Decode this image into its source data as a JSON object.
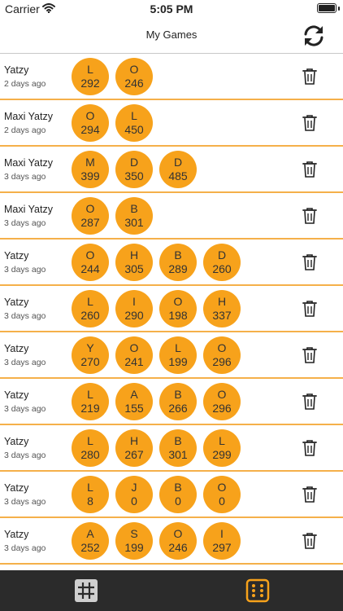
{
  "status": {
    "carrier": "Carrier",
    "time": "5:05 PM"
  },
  "nav": {
    "title": "My Games"
  },
  "icons": {
    "refresh": "refresh-icon",
    "trash": "trash-icon",
    "grid": "grid-tab-icon",
    "dice": "dice-tab-icon"
  },
  "colors": {
    "accent": "#f7a21b",
    "separator": "#f5b04a",
    "tab_bar": "#2b2b2b"
  },
  "games": [
    {
      "name": "Yatzy",
      "time": "2 days ago",
      "players": [
        {
          "initial": "L",
          "score": "292"
        },
        {
          "initial": "O",
          "score": "246"
        }
      ]
    },
    {
      "name": "Maxi Yatzy",
      "time": "2 days ago",
      "players": [
        {
          "initial": "O",
          "score": "294"
        },
        {
          "initial": "L",
          "score": "450"
        }
      ]
    },
    {
      "name": "Maxi Yatzy",
      "time": "3 days ago",
      "players": [
        {
          "initial": "M",
          "score": "399"
        },
        {
          "initial": "D",
          "score": "350"
        },
        {
          "initial": "D",
          "score": "485"
        }
      ]
    },
    {
      "name": "Maxi Yatzy",
      "time": "3 days ago",
      "players": [
        {
          "initial": "O",
          "score": "287"
        },
        {
          "initial": "B",
          "score": "301"
        }
      ]
    },
    {
      "name": "Yatzy",
      "time": "3 days ago",
      "players": [
        {
          "initial": "O",
          "score": "244"
        },
        {
          "initial": "H",
          "score": "305"
        },
        {
          "initial": "B",
          "score": "289"
        },
        {
          "initial": "D",
          "score": "260"
        }
      ]
    },
    {
      "name": "Yatzy",
      "time": "3 days ago",
      "players": [
        {
          "initial": "L",
          "score": "260"
        },
        {
          "initial": "I",
          "score": "290"
        },
        {
          "initial": "O",
          "score": "198"
        },
        {
          "initial": "H",
          "score": "337"
        }
      ]
    },
    {
      "name": "Yatzy",
      "time": "3 days ago",
      "players": [
        {
          "initial": "Y",
          "score": "270"
        },
        {
          "initial": "O",
          "score": "241"
        },
        {
          "initial": "L",
          "score": "199"
        },
        {
          "initial": "O",
          "score": "296"
        }
      ]
    },
    {
      "name": "Yatzy",
      "time": "3 days ago",
      "players": [
        {
          "initial": "L",
          "score": "219"
        },
        {
          "initial": "A",
          "score": "155"
        },
        {
          "initial": "B",
          "score": "266"
        },
        {
          "initial": "O",
          "score": "296"
        }
      ]
    },
    {
      "name": "Yatzy",
      "time": "3 days ago",
      "players": [
        {
          "initial": "L",
          "score": "280"
        },
        {
          "initial": "H",
          "score": "267"
        },
        {
          "initial": "B",
          "score": "301"
        },
        {
          "initial": "L",
          "score": "299"
        }
      ]
    },
    {
      "name": "Yatzy",
      "time": "3 days ago",
      "players": [
        {
          "initial": "L",
          "score": "8"
        },
        {
          "initial": "J",
          "score": "0"
        },
        {
          "initial": "B",
          "score": "0"
        },
        {
          "initial": "O",
          "score": "0"
        }
      ]
    },
    {
      "name": "Yatzy",
      "time": "3 days ago",
      "players": [
        {
          "initial": "A",
          "score": "252"
        },
        {
          "initial": "S",
          "score": "199"
        },
        {
          "initial": "O",
          "score": "246"
        },
        {
          "initial": "I",
          "score": "297"
        }
      ]
    }
  ]
}
